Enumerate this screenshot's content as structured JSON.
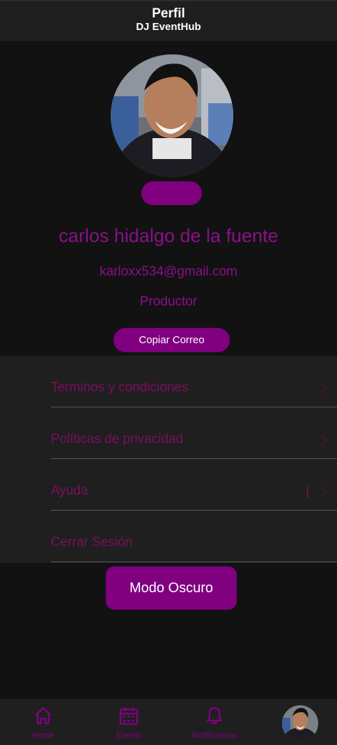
{
  "header": {
    "title": "Perfil",
    "subtitle": "DJ EventHub"
  },
  "profile": {
    "name": "carlos hidalgo de la fuente",
    "email": "karloxx534@gmail.com",
    "role": "Productor",
    "copy_button": "Copiar Correo"
  },
  "menu": [
    {
      "label": "Terminos y condiciones"
    },
    {
      "label": "Políticas de privacidad"
    },
    {
      "label": "Ayuda",
      "separator": "|"
    },
    {
      "label": "Cerrar Sesión"
    }
  ],
  "dark_mode_button": "Modo Oscuro",
  "bottom_nav": [
    {
      "label": "Home",
      "icon": "home-icon"
    },
    {
      "label": "Events",
      "icon": "calendar-icon"
    },
    {
      "label": "Notifications",
      "icon": "bell-icon"
    },
    {
      "label": "",
      "icon": "avatar"
    }
  ],
  "colors": {
    "accent": "#800080",
    "background": "#121212",
    "surface": "#1f1f1f",
    "menu_text": "#7a0f5e"
  }
}
